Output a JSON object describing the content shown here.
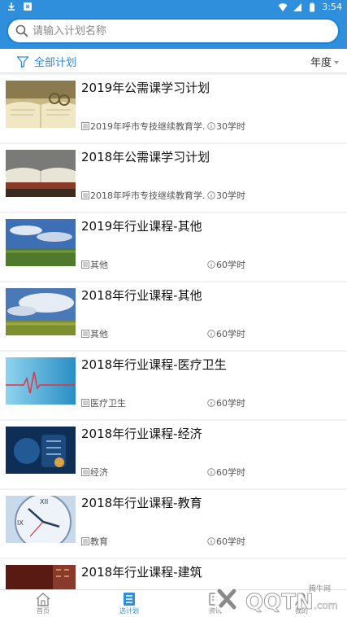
{
  "status_bar": {
    "time": "3:54"
  },
  "search": {
    "placeholder": "请输入计划名称",
    "value": ""
  },
  "filter": {
    "all_label": "全部计划",
    "year_label": "年度"
  },
  "courses": [
    {
      "title": "2019年公需课学习计划",
      "category": "2019年呼市专技继续教育学...",
      "hours": "30学时",
      "image": "book-light"
    },
    {
      "title": "2018年公需课学习计划",
      "category": "2018年呼市专技继续教育学...",
      "hours": "30学时",
      "image": "books-dark"
    },
    {
      "title": "2019年行业课程-其他",
      "category": "其他",
      "hours": "60学时",
      "image": "grassland-sky"
    },
    {
      "title": "2018年行业课程-其他",
      "category": "其他",
      "hours": "60学时",
      "image": "grassland-clouds"
    },
    {
      "title": "2018年行业课程-医疗卫生",
      "category": "医疗卫生",
      "hours": "60学时",
      "image": "heartbeat-line"
    },
    {
      "title": "2018年行业课程-经济",
      "category": "经济",
      "hours": "60学时",
      "image": "money-digital"
    },
    {
      "title": "2018年行业课程-教育",
      "category": "教育",
      "hours": "60学时",
      "image": "clock-face"
    },
    {
      "title": "2018年行业课程-建筑",
      "category": "",
      "hours": "",
      "image": "building-red"
    }
  ],
  "bottom_nav": [
    {
      "label": "首页",
      "icon": "home-icon",
      "active": false
    },
    {
      "label": "选计划",
      "icon": "list-icon",
      "active": true
    },
    {
      "label": "资讯",
      "icon": "news-icon",
      "active": false
    },
    {
      "label": "我的",
      "icon": "user-icon",
      "active": false
    }
  ],
  "watermark": {
    "brand": "QQTN",
    "sub": "腾牛网",
    "domain": ".com"
  },
  "colors": {
    "primary": "#2f8fdc",
    "accent_text": "#2e8bd8",
    "background": "#f2f2f2"
  }
}
